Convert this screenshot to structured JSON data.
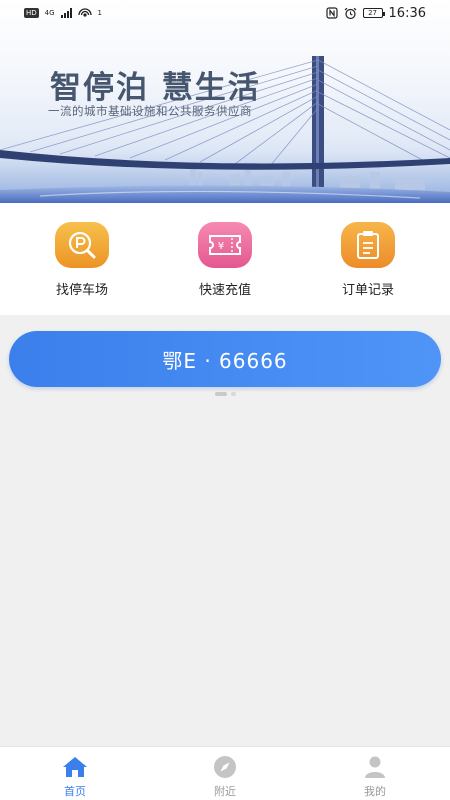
{
  "status_bar": {
    "hd": "HD",
    "network": "4G",
    "hotspot_count": "1",
    "battery": "27",
    "time": "16:36"
  },
  "banner": {
    "title": "智停泊 慧生活",
    "subtitle": "一流的城市基础设施和公共服务供应商"
  },
  "quick_actions": [
    {
      "label": "找停车场",
      "icon": "parking-search-icon",
      "color": "#f0a030"
    },
    {
      "label": "快速充值",
      "icon": "recharge-ticket-icon",
      "color": "#ea6a9a"
    },
    {
      "label": "订单记录",
      "icon": "clipboard-icon",
      "color": "#f09a32"
    }
  ],
  "plate": {
    "number": "鄂E · 66666",
    "pager": {
      "total": 2,
      "active": 1
    }
  },
  "bottom_nav": [
    {
      "label": "首页",
      "icon": "home-icon",
      "active": true
    },
    {
      "label": "附近",
      "icon": "compass-icon",
      "active": false
    },
    {
      "label": "我的",
      "icon": "person-icon",
      "active": false
    }
  ],
  "colors": {
    "primary": "#3b7fec",
    "nav_inactive": "#999999"
  }
}
